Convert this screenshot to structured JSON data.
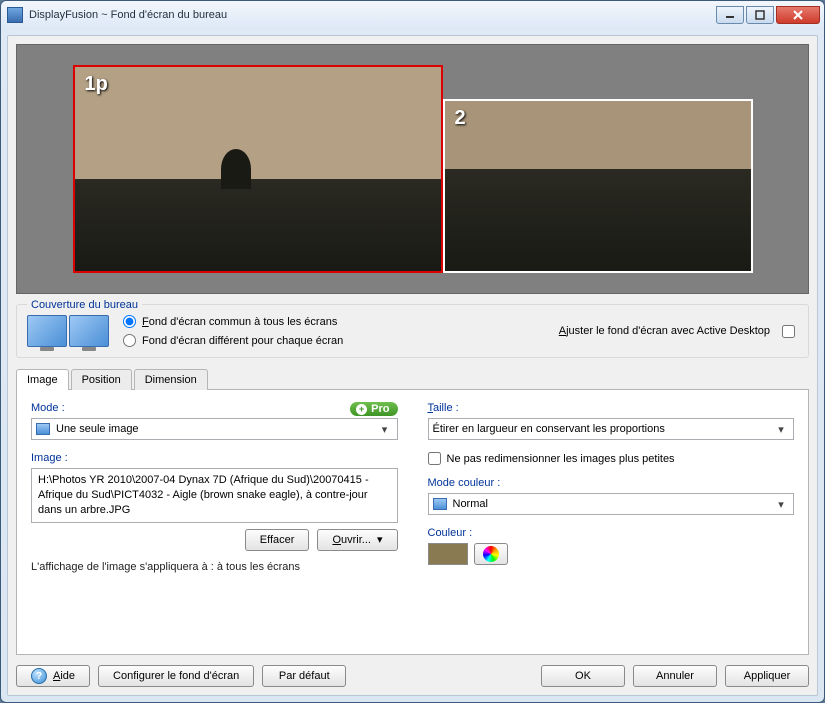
{
  "window": {
    "title": "DisplayFusion ~ Fond d'écran du bureau"
  },
  "preview": {
    "monitors": [
      {
        "label": "1p",
        "primary": true
      },
      {
        "label": "2",
        "primary": false
      }
    ]
  },
  "coverage": {
    "legend": "Couverture du bureau",
    "radio_common": "Fond d'écran commun à tous les écrans",
    "radio_different": "Fond d'écran différent pour chaque écran",
    "selected": "common",
    "adjust_label": "Ajuster le fond d'écran avec Active Desktop",
    "adjust_checked": false
  },
  "tabs": {
    "image": "Image",
    "position": "Position",
    "dimension": "Dimension",
    "active": "image"
  },
  "mode": {
    "label": "Mode :",
    "value": "Une seule image",
    "pro_badge": "Pro"
  },
  "image_field": {
    "label": "Image :",
    "value": "H:\\Photos YR 2010\\2007-04 Dynax 7D (Afrique du Sud)\\20070415 - Afrique du Sud\\PICT4032 - Aigle (brown snake eagle), à contre-jour dans un arbre.JPG"
  },
  "image_buttons": {
    "clear": "Effacer",
    "open": "Ouvrir..."
  },
  "taille": {
    "label": "Taille :",
    "value": "Étirer en largueur en conservant les proportions"
  },
  "no_resize": {
    "label": "Ne pas redimensionner les images plus petites",
    "checked": false
  },
  "color_mode": {
    "label": "Mode couleur :",
    "value": "Normal"
  },
  "couleur": {
    "label": "Couleur :",
    "hex": "#8a7a52"
  },
  "note": "L'affichage de l'image s'appliquera à : à tous les écrans",
  "dialog": {
    "help": "Aide",
    "configure": "Configurer le fond d'écran",
    "default": "Par défaut",
    "ok": "OK",
    "cancel": "Annuler",
    "apply": "Appliquer"
  }
}
